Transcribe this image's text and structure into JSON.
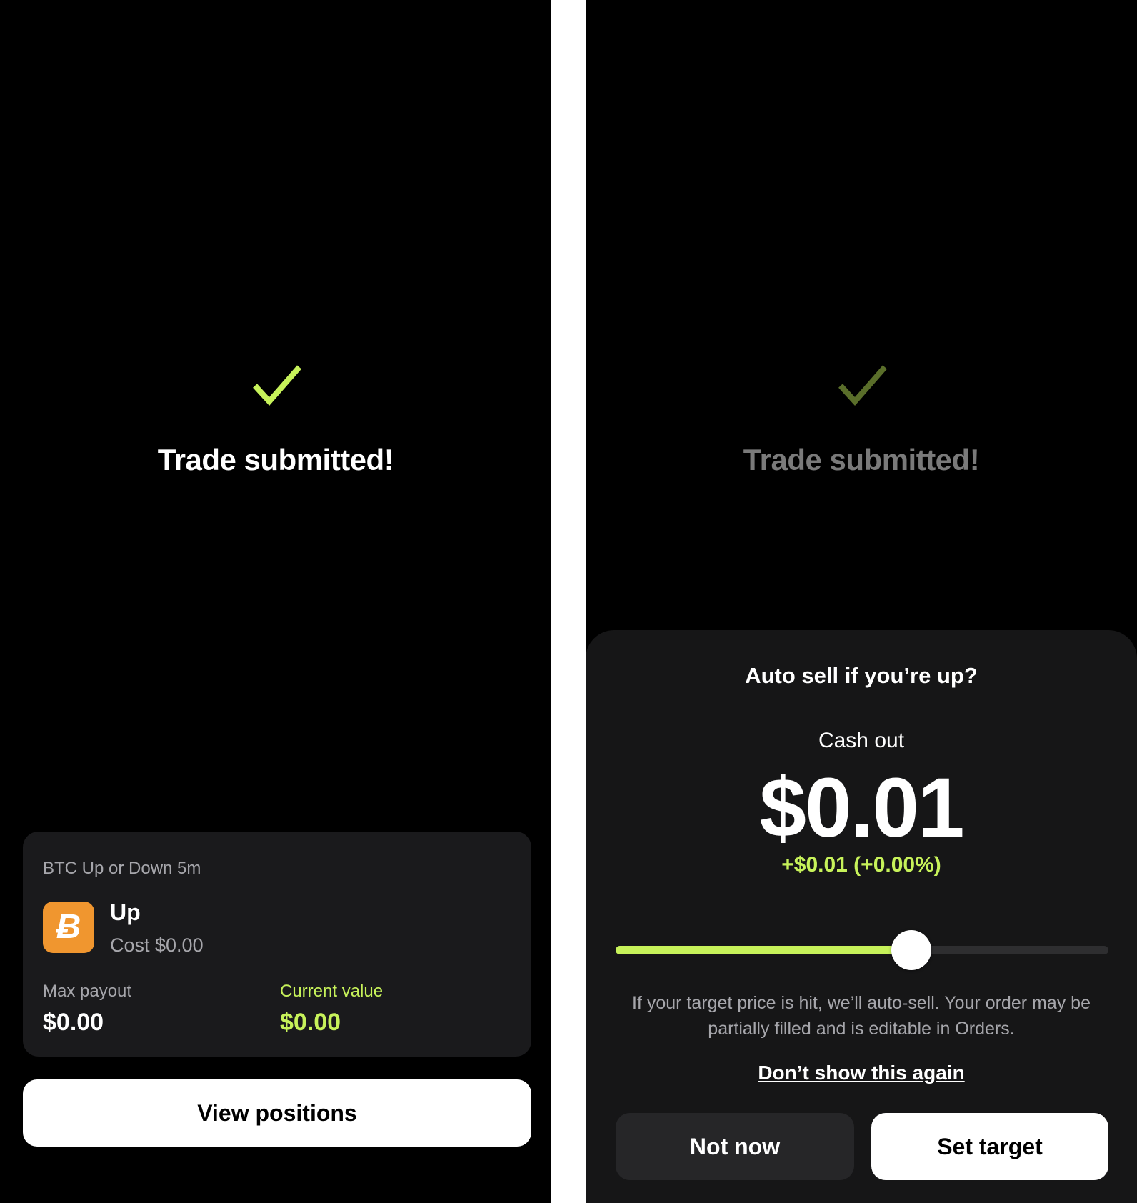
{
  "colors": {
    "accent_green": "#c7f25a",
    "bitcoin_orange": "#f0962f",
    "card_background": "#1a1a1c",
    "sheet_background": "#161617"
  },
  "left_screen": {
    "status_icon": "checkmark-icon",
    "headline": "Trade submitted!",
    "trade_card": {
      "market_title": "BTC Up or Down 5m",
      "asset_icon": "bitcoin-icon",
      "asset_symbol": "Ƀ",
      "outcome": "Up",
      "cost": "Cost $0.00",
      "max_payout_label": "Max payout",
      "max_payout_value": "$0.00",
      "current_value_label": "Current value",
      "current_value_value": "$0.00"
    },
    "view_positions_label": "View positions"
  },
  "right_screen": {
    "status_icon": "checkmark-icon",
    "headline": "Trade submitted!",
    "auto_sell_sheet": {
      "title": "Auto sell if you’re up?",
      "cash_out_label": "Cash out",
      "cash_out_amount": "$0.01",
      "change": "+$0.01 (+0.00%)",
      "slider_fraction": 0.6,
      "info": "If your target price is hit, we’ll auto-sell. Your order may be partially filled and is editable in Orders.",
      "dont_show_again": "Don’t show this again",
      "not_now_label": "Not now",
      "set_target_label": "Set target"
    }
  }
}
